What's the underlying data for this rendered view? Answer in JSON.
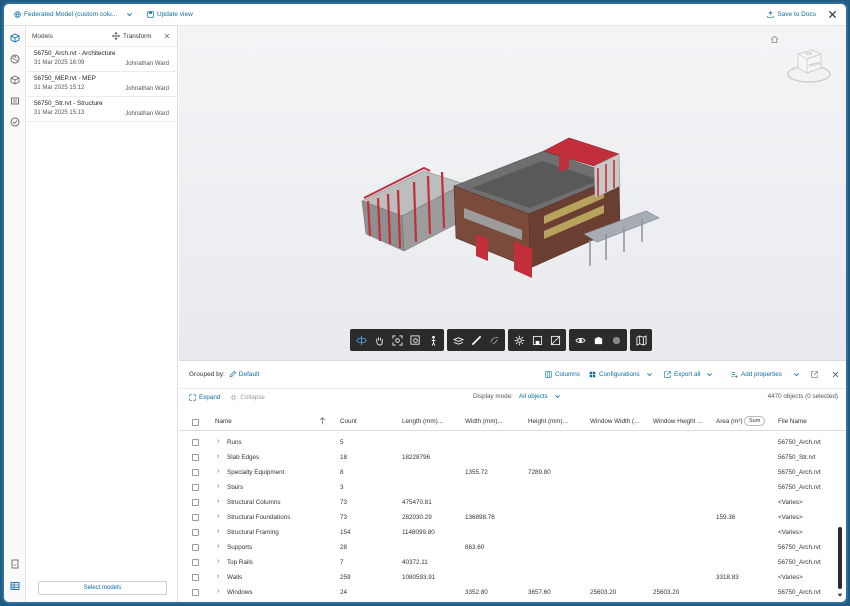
{
  "topbar": {
    "model_selector": "Federated Model (custom colu...",
    "update_view": "Update view",
    "save_to_docs": "Save to Docs"
  },
  "models_panel": {
    "title": "Models",
    "transform": "Transform",
    "items": [
      {
        "name": "56750_Arch.rvt - Architecture",
        "date": "31 Mar 2025 16:09",
        "user": "Johnathan Ward"
      },
      {
        "name": "56750_MEP.rvt - MEP",
        "date": "31 Mar 2025 15:12",
        "user": "Johnathan Ward"
      },
      {
        "name": "56750_Str.rvt - Structure",
        "date": "31 Mar 2025 15:13",
        "user": "Johnathan Ward"
      }
    ],
    "select_models": "Select models"
  },
  "viewcube": {
    "top": "TOP",
    "front": "FRONT"
  },
  "grid": {
    "grouped_by_label": "Grouped by:",
    "grouped_by_value": "Default",
    "columns": "Columns",
    "configurations": "Configurations",
    "export_all": "Export all",
    "add_properties": "Add properties",
    "expand": "Expand",
    "collapse": "Collapse",
    "display_mode_label": "Display mode:",
    "display_mode_value": "All objects",
    "objects_count": "4470 objects (0 selected)",
    "headers": {
      "name": "Name",
      "count": "Count",
      "length": "Length (mm)...",
      "width": "Width (mm)...",
      "height": "Height (mm)...",
      "window_width": "Window Width (...",
      "window_height": "Window Height ...",
      "area": "Area (m²)",
      "sum": "Sum",
      "file_name": "File Name"
    },
    "rows": [
      {
        "name": "Runs",
        "count": "5",
        "length": "",
        "width": "",
        "height": "",
        "ww": "",
        "wh": "",
        "area": "",
        "file": "56750_Arch.rvt"
      },
      {
        "name": "Slab Edges",
        "count": "18",
        "length": "18228796",
        "width": "",
        "height": "",
        "ww": "",
        "wh": "",
        "area": "",
        "file": "56750_Str.rvt"
      },
      {
        "name": "Specialty Equipment",
        "count": "8",
        "length": "",
        "width": "1355.72",
        "height": "7289.80",
        "ww": "",
        "wh": "",
        "area": "",
        "file": "56750_Arch.rvt"
      },
      {
        "name": "Stairs",
        "count": "3",
        "length": "",
        "width": "",
        "height": "",
        "ww": "",
        "wh": "",
        "area": "",
        "file": "56750_Arch.rvt"
      },
      {
        "name": "Structural Columns",
        "count": "73",
        "length": "475470.81",
        "width": "",
        "height": "",
        "ww": "",
        "wh": "",
        "area": "",
        "file": "<Varies>"
      },
      {
        "name": "Structural Foundations",
        "count": "73",
        "length": "282030.29",
        "width": "136898.76",
        "height": "",
        "ww": "",
        "wh": "",
        "area": "159.36",
        "file": "<Varies>"
      },
      {
        "name": "Structural Framing",
        "count": "154",
        "length": "1148099.80",
        "width": "",
        "height": "",
        "ww": "",
        "wh": "",
        "area": "",
        "file": "<Varies>"
      },
      {
        "name": "Supports",
        "count": "28",
        "length": "",
        "width": "863.60",
        "height": "",
        "ww": "",
        "wh": "",
        "area": "",
        "file": "56750_Arch.rvt"
      },
      {
        "name": "Top Rails",
        "count": "7",
        "length": "40372.11",
        "width": "",
        "height": "",
        "ww": "",
        "wh": "",
        "area": "",
        "file": "56750_Arch.rvt"
      },
      {
        "name": "Walls",
        "count": "259",
        "length": "1080593.91",
        "width": "",
        "height": "",
        "ww": "",
        "wh": "",
        "area": "3318.83",
        "file": "<Varies>"
      },
      {
        "name": "Windows",
        "count": "24",
        "length": "",
        "width": "3352.80",
        "height": "3657.60",
        "ww": "25603.20",
        "wh": "25603.20",
        "area": "",
        "file": "56750_Arch.rvt"
      }
    ]
  }
}
